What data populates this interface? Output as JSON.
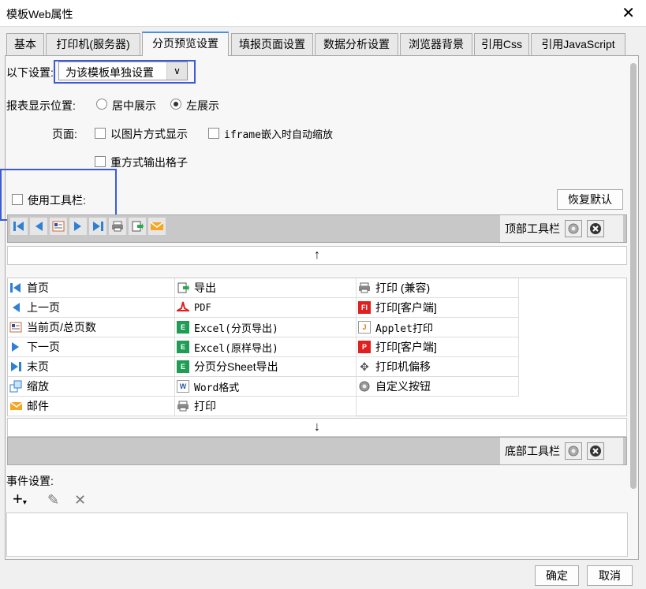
{
  "window": {
    "title": "模板Web属性"
  },
  "tabs": [
    "基本",
    "打印机(服务器)",
    "分页预览设置",
    "填报页面设置",
    "数据分析设置",
    "浏览器背景",
    "引用Css",
    "引用JavaScript"
  ],
  "settings": {
    "label": "以下设置:",
    "value": "为该模板单独设置"
  },
  "position": {
    "label": "报表显示位置:",
    "center": "居中展示",
    "left": "左展示"
  },
  "page": {
    "label": "页面:",
    "image_mode": "以图片方式显示",
    "iframe": "iframe嵌入时自动缩放",
    "repeat": "重方式输出格子"
  },
  "toolbar": {
    "use_label": "使用工具栏:",
    "restore": "恢复默认",
    "top_label": "顶部工具栏",
    "bottom_label": "底部工具栏"
  },
  "items": {
    "col1": [
      "首页",
      "上一页",
      "当前页/总页数",
      "下一页",
      "末页",
      "缩放",
      "邮件"
    ],
    "col2": [
      "导出",
      "PDF",
      "Excel(分页导出)",
      "Excel(原样导出)",
      "分页分Sheet导出",
      "Word格式",
      "打印"
    ],
    "col3": [
      "打印 (兼容)",
      "打印[客户端]",
      "Applet打印",
      "打印[客户端]",
      "打印机偏移",
      "自定义按钮"
    ]
  },
  "events": {
    "label": "事件设置:"
  },
  "footer": {
    "ok": "确定",
    "cancel": "取消"
  }
}
